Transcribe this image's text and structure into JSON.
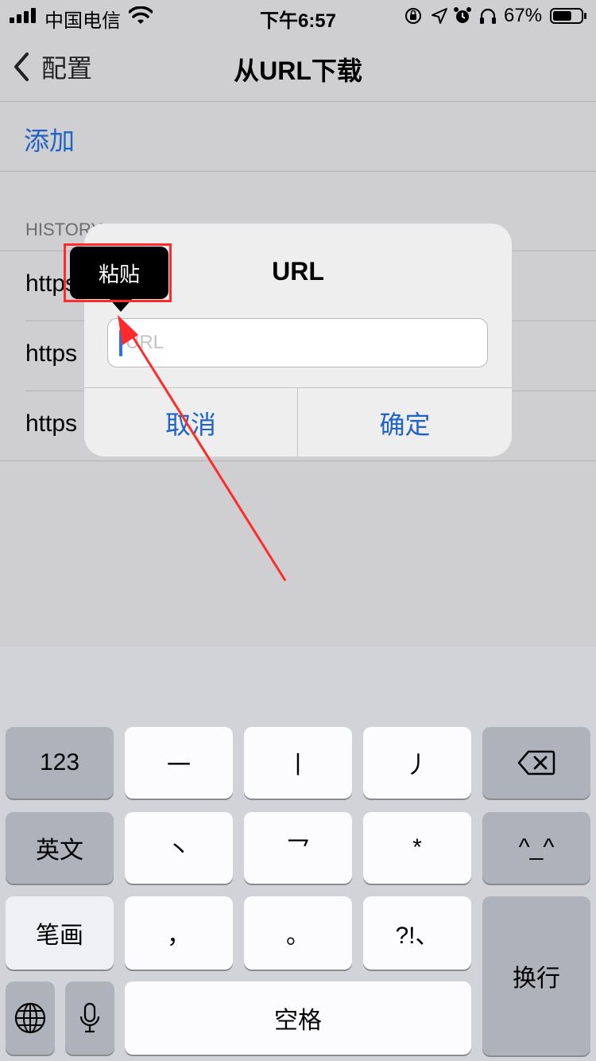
{
  "status_bar": {
    "carrier": "中国电信",
    "time": "下午6:57",
    "battery_percent": "67%",
    "battery_level": 0.67,
    "icons": [
      "orientation-lock-icon",
      "location-icon",
      "alarm-icon",
      "headphones-icon"
    ]
  },
  "nav": {
    "back_label": "配置",
    "title": "从URL下载"
  },
  "add_row": {
    "label": "添加"
  },
  "history": {
    "header": "HISTORY",
    "items": [
      "https",
      "https",
      "https"
    ]
  },
  "alert": {
    "title": "URL",
    "input_placeholder": "URL",
    "input_value": "",
    "cancel_label": "取消",
    "confirm_label": "确定"
  },
  "paste_menu": {
    "label": "粘贴"
  },
  "keyboard": {
    "row1": [
      "123",
      "一",
      "丨",
      "丿",
      "delete-icon"
    ],
    "row2": [
      "英文",
      "丶",
      "乛",
      "*",
      "^_^"
    ],
    "row3": [
      "笔画",
      "，",
      "。",
      "?!、"
    ],
    "row4": [
      "globe-icon",
      "microphone-icon",
      "空格"
    ],
    "return_label": "换行"
  },
  "colors": {
    "accent": "#1f63c8",
    "annotation": "#ff2a2a",
    "keyboard_bg": "#d2d3d8"
  }
}
